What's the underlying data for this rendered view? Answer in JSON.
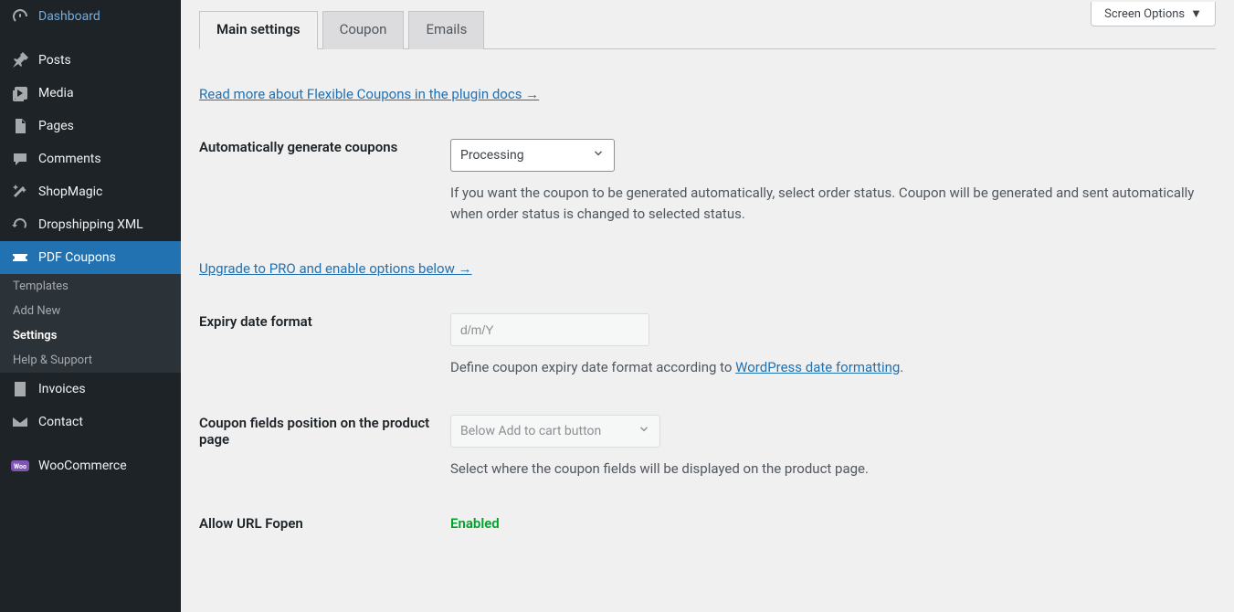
{
  "screenOptions": "Screen Options",
  "sidebar": {
    "dashboard": "Dashboard",
    "posts": "Posts",
    "media": "Media",
    "pages": "Pages",
    "comments": "Comments",
    "shopmagic": "ShopMagic",
    "dropshipping": "Dropshipping XML",
    "pdfcoupons": "PDF Coupons",
    "invoices": "Invoices",
    "contact": "Contact",
    "woocommerce": "WooCommerce",
    "submenu": {
      "templates": "Templates",
      "addnew": "Add New",
      "settings": "Settings",
      "help": "Help & Support"
    }
  },
  "tabs": {
    "main": "Main settings",
    "coupon": "Coupon",
    "emails": "Emails"
  },
  "content": {
    "docLink": "Read more about Flexible Coupons in the plugin docs →",
    "autoGen": {
      "label": "Automatically generate coupons",
      "value": "Processing",
      "desc": "If you want the coupon to be generated automatically, select order status. Coupon will be generated and sent automatically when order status is changed to selected status."
    },
    "upgradeLink": "Upgrade to PRO and enable options below →",
    "expiry": {
      "label": "Expiry date format",
      "placeholder": "d/m/Y",
      "descPrefix": "Define coupon expiry date format according to ",
      "descLink": "WordPress date formatting",
      "descSuffix": "."
    },
    "position": {
      "label": "Coupon fields position on the product page",
      "value": "Below Add to cart button",
      "desc": "Select where the coupon fields will be displayed on the product page."
    },
    "fopen": {
      "label": "Allow URL Fopen",
      "value": "Enabled"
    }
  }
}
